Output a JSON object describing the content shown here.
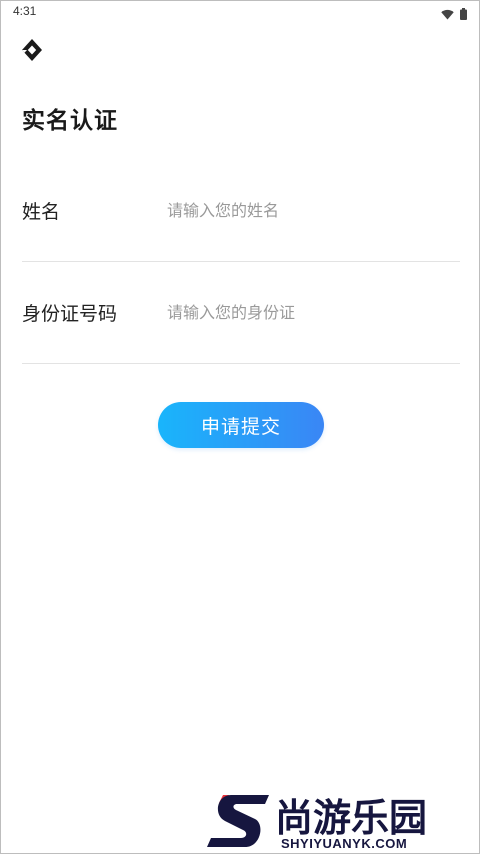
{
  "status_bar": {
    "time": "4:31",
    "icons": [
      "wifi-icon",
      "battery-icon"
    ]
  },
  "header": {
    "back_icon": "diamond-logo-icon",
    "title": "实名认证"
  },
  "form": {
    "name": {
      "label": "姓名",
      "placeholder": "请输入您的姓名",
      "value": ""
    },
    "id_number": {
      "label": "身份证号码",
      "placeholder": "请输入您的身份证",
      "value": ""
    }
  },
  "submit": {
    "label": "申请提交"
  },
  "watermark": {
    "cn_text": "尚游乐园",
    "en_text": "SHYIYUANYK.COM"
  },
  "colors": {
    "button_gradient_start": "#19b5fb",
    "button_gradient_end": "#3a86f5",
    "divider": "#e3e3e3",
    "placeholder": "#9a9a9a",
    "watermark_navy": "#16163f",
    "watermark_red": "#e8333c"
  }
}
